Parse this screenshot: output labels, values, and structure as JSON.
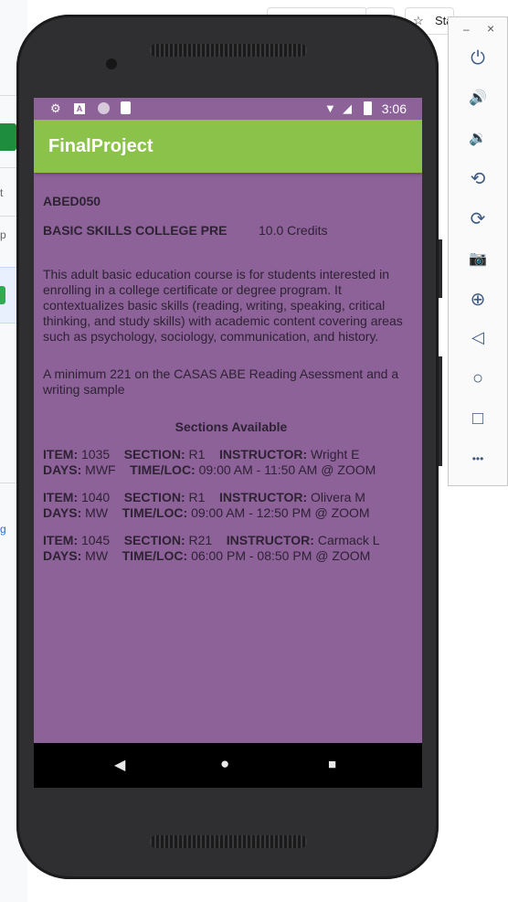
{
  "browser_fragments": {
    "left_texts": [
      "t",
      "p"
    ],
    "left_link": "g",
    "star_label": "Sta"
  },
  "emulator_toolbar": {
    "window_buttons": {
      "minimize": "–",
      "close": "×"
    },
    "buttons": [
      {
        "name": "power",
        "glyph": "⏻"
      },
      {
        "name": "volume-up",
        "glyph": "🔊"
      },
      {
        "name": "volume-down",
        "glyph": "🔉"
      },
      {
        "name": "rotate-left",
        "glyph": "⟲"
      },
      {
        "name": "rotate-right",
        "glyph": "⟳"
      },
      {
        "name": "camera",
        "glyph": "📷"
      },
      {
        "name": "zoom",
        "glyph": "⊕"
      },
      {
        "name": "back",
        "glyph": "◁"
      },
      {
        "name": "home",
        "glyph": "○"
      },
      {
        "name": "overview",
        "glyph": "□"
      },
      {
        "name": "more",
        "glyph": "•••"
      }
    ]
  },
  "status_bar": {
    "time": "3:06",
    "left_icons": [
      "gear-icon",
      "a-icon",
      "circle-icon",
      "sd-card-icon"
    ],
    "right_icons": [
      "wifi-icon",
      "signal-icon",
      "battery-icon"
    ]
  },
  "app_bar": {
    "title": "FinalProject",
    "color": "#8bc34a"
  },
  "course": {
    "code": "ABED050",
    "name": "BASIC SKILLS COLLEGE PRE",
    "credits": "10.0 Credits",
    "description": "This adult basic education course is for students interested in enrolling in a college certificate or degree program. It contextualizes basic skills (reading, writing, speaking, critical thinking, and study skills) with academic content covering areas such as psychology, sociology, communication, and history.",
    "prerequisite": "A minimum 221 on the CASAS ABE Reading Asessment and a writing sample",
    "sections_title": "Sections Available",
    "labels": {
      "item": "ITEM:",
      "section": "SECTION:",
      "instructor": "INSTRUCTOR:",
      "days": "DAYS:",
      "timeloc": "TIME/LOC:"
    },
    "sections": [
      {
        "item": "1035",
        "section": "R1",
        "instructor": "Wright E",
        "days": "MWF",
        "timeloc": "09:00 AM - 11:50 AM @ ZOOM"
      },
      {
        "item": "1040",
        "section": "R1",
        "instructor": "Olivera M",
        "days": "MW",
        "timeloc": "09:00 AM - 12:50 PM @ ZOOM"
      },
      {
        "item": "1045",
        "section": "R21",
        "instructor": "Carmack L",
        "days": "MW",
        "timeloc": "06:00 PM - 08:50 PM @ ZOOM"
      }
    ]
  },
  "nav_bar": {
    "back": "◀",
    "home": "●",
    "recents": "■"
  },
  "colors": {
    "screen_bg": "#8c6299",
    "text": "#2e2233",
    "phone_body": "#2f2f31"
  }
}
